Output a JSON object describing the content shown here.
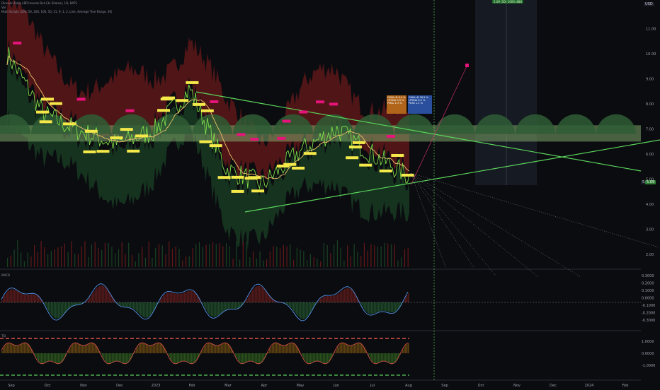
{
  "header": {
    "symbol_line": "Direxion Daily LBR Inverse Bull (3x Shares), 1D, BATS",
    "volume_line": "Vol",
    "indicator_line": "Multi Scripts (200, 50, 200, 100, 50, 21, 9, 1, 2, Line, Average True Range, 20)"
  },
  "currency": "USD",
  "price_axis": {
    "ticks": [
      "11.00",
      "10.00",
      "9.00",
      "8.00",
      "7.00",
      "6.00",
      "5.00",
      "4.00",
      "3.00",
      "2.00"
    ],
    "last_price": "5.09",
    "last_label": "5.05"
  },
  "osc1_axis": [
    "0.3000",
    "0.2000",
    "0.1000",
    "0.0000",
    "-0.1000",
    "-0.2000",
    "-0.3000"
  ],
  "osc2_axis": [
    "1.0000",
    "0.0000",
    "-1.0000"
  ],
  "osc1_title": "MACD",
  "osc2_title": "TSI",
  "time_axis": [
    "Sep",
    "Oct",
    "Nov",
    "Dec",
    "2023",
    "Feb",
    "Mar",
    "Apr",
    "May",
    "Jun",
    "Jul",
    "Aug",
    "Sep",
    "Oct",
    "Nov",
    "Dec",
    "2024",
    "Feb"
  ],
  "projection_label": "5.09 (50) 100% 888",
  "info_box_left": [
    "CMHI=B 6.4 %",
    "UPSMA 3.9 %",
    "PMAL 1.3 %"
  ],
  "info_box_right": [
    "CMHI=B 18.5 %",
    "UPSMA 8.2 %",
    "PEAE 1.1 %"
  ],
  "colors": {
    "background": "#0b0c10",
    "band_upper": "#8a1e1e",
    "band_lower": "#1f5a2c",
    "price_line": "#7fdc4a",
    "trend_line": "#5cd65c",
    "label_yellow": "#f5e94a",
    "label_pink": "#e6147a",
    "cloud": "#7fa86a"
  },
  "chart_data": {
    "type": "line",
    "title": "",
    "x": [
      "Sep",
      "Oct",
      "Nov",
      "Dec",
      "2023",
      "Feb",
      "Mar",
      "Apr",
      "May",
      "Jun",
      "Jul",
      "Aug"
    ],
    "series": [
      {
        "values": [
          10.0,
          7.6,
          6.9,
          6.4,
          6.9,
          8.6,
          5.4,
          4.8,
          6.1,
          7.0,
          6.0,
          5.1
        ]
      }
    ],
    "ylim": [
      1.5,
      12.0
    ],
    "xlabel": "",
    "ylabel": "",
    "grid": true
  }
}
